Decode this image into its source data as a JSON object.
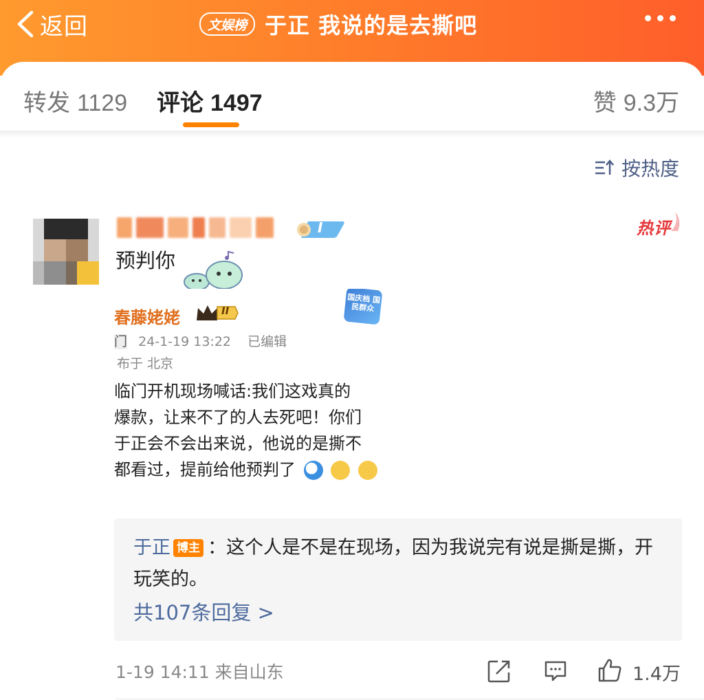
{
  "header": {
    "back_label": "返回",
    "badge": "文娱榜",
    "title": "于正 我说的是去撕吧"
  },
  "tabs": {
    "repost_label": "转发",
    "repost_count": "1129",
    "comment_label": "评论",
    "comment_count": "1497",
    "like_label": "赞",
    "like_count": "9.3万"
  },
  "sort": {
    "label": "按热度"
  },
  "comment": {
    "hot_label": "热评",
    "vip_level": "I",
    "text": "预判你",
    "embedded": {
      "author": "春藤姥姥",
      "crown_level": "II",
      "sticker_text": "国庆档 国民群众",
      "meta_prefix": "门",
      "time": "24-1-19 13:22",
      "edited": "已编辑",
      "location": "布于 北京",
      "lines": [
        "临门开机现场喊话:我们这戏真的",
        "爆款，让来不了的人去死吧！你们",
        "于正会不会出来说，他说的是撕不",
        "都看过，提前给他预判了"
      ]
    },
    "reply": {
      "author": "于正",
      "badge": "博主",
      "text": "：这个人是不是在现场，因为我说完有说是撕是撕，开玩笑的。",
      "more": "共107条回复 >"
    },
    "footer": {
      "meta": "1-19 14:11 来自山东",
      "like_count": "1.4万"
    }
  },
  "colors": {
    "header_start": "#ff9a2e",
    "header_end": "#ff5e2a",
    "accent": "#ff8200",
    "link": "#4d6a9e",
    "hot": "#e5383b"
  }
}
